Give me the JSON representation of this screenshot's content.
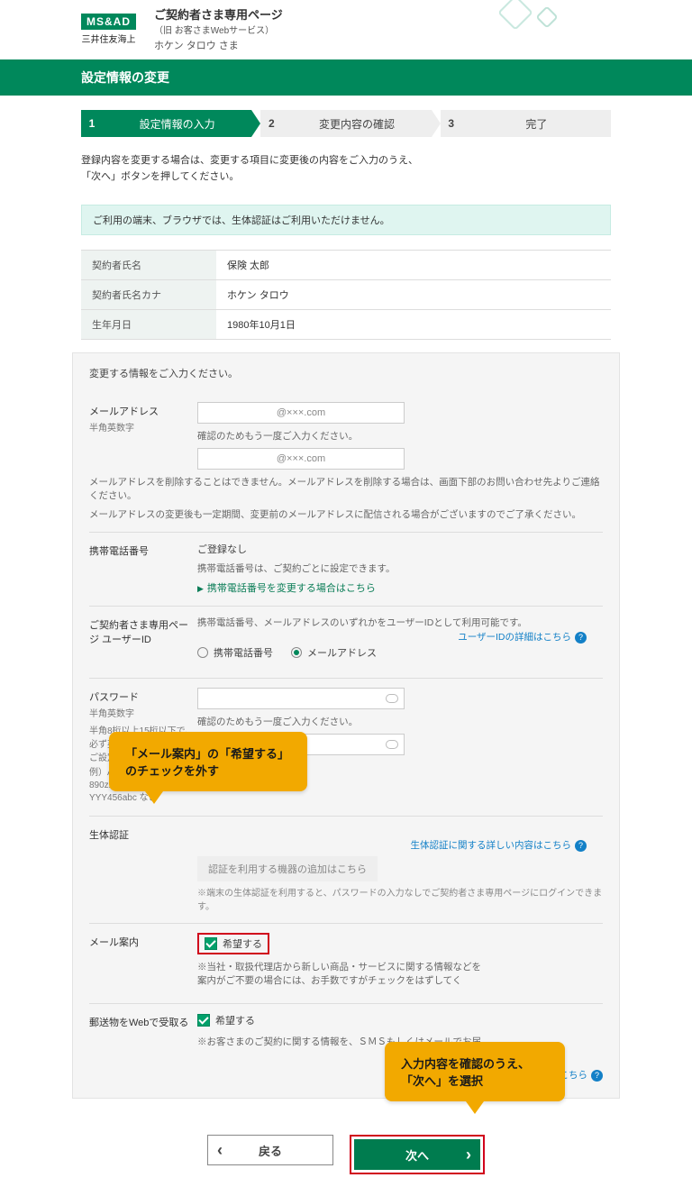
{
  "header": {
    "brand_logo": "MS&AD",
    "brand_sub": "三井住友海上",
    "page_owner_title": "ご契約者さま専用ページ",
    "page_owner_sub": "（旧 お客さまWebサービス）",
    "user_greeting": "ホケン タロウ さま"
  },
  "title": "設定情報の変更",
  "steps": [
    {
      "num": "1",
      "label": "設定情報の入力",
      "active": true
    },
    {
      "num": "2",
      "label": "変更内容の確認",
      "active": false
    },
    {
      "num": "3",
      "label": "完了",
      "active": false
    }
  ],
  "intro_line1": "登録内容を変更する場合は、変更する項目に変更後の内容をご入力のうえ、",
  "intro_line2": "「次へ」ボタンを押してください。",
  "notice": "ご利用の端末、ブラウザでは、生体認証はご利用いただけません。",
  "info": {
    "name_label": "契約者氏名",
    "name_value": "保険 太郎",
    "kana_label": "契約者氏名カナ",
    "kana_value": "ホケン タロウ",
    "dob_label": "生年月日",
    "dob_value": "1980年10月1日"
  },
  "panel_intro": "変更する情報をご入力ください。",
  "email": {
    "label": "メールアドレス",
    "sublabel": "半角英数字",
    "value": "@×××.com",
    "confirm_hint": "確認のためもう一度ご入力ください。",
    "confirm_value": "@×××.com",
    "delete_note": "メールアドレスを削除することはできません。メールアドレスを削除する場合は、画面下部のお問い合わせ先よりご連絡ください。",
    "retain_note": "メールアドレスの変更後も一定期間、変更前のメールアドレスに配信される場合がございますのでご了承ください。"
  },
  "mobile": {
    "label": "携帯電話番号",
    "none": "ご登録なし",
    "per_contract": "携帯電話番号は、ご契約ごとに設定できます。",
    "change_link": "携帯電話番号を変更する場合はこちら"
  },
  "userid": {
    "label": "ご契約者さま専用ページ ユーザーID",
    "desc": "携帯電話番号、メールアドレスのいずれかをユーザーIDとして利用可能です。",
    "opt_phone": "携帯電話番号",
    "opt_email": "メールアドレス",
    "detail_link": "ユーザーIDの詳細はこちら"
  },
  "password": {
    "label": "パスワード",
    "sublabel": "半角英数字",
    "rule": "半角8桁以上15桁以下で、必ず英字と数字を混ぜてご設定ください。",
    "confirm_hint": "確認のためもう一度ご入力ください。",
    "example_label": "例）Abc12345、890zXY1234、YYY456abc など"
  },
  "biometric": {
    "label": "生体認証",
    "add_device": "認証を利用する機器の追加はこちら",
    "note": "※端末の生体認証を利用すると、パスワードの入力なしでご契約者さま専用ページにログインできます。",
    "detail_link": "生体認証に関する詳しい内容はこちら"
  },
  "mail_guide": {
    "label": "メール案内",
    "want": "希望する",
    "note": "※当社・取扱代理店から新しい商品・サービスに関する情報などを\n案内がご不要の場合には、お手数ですがチェックをはずしてく"
  },
  "postal_web": {
    "label": "郵送物をWebで受取る",
    "want": "希望する",
    "note": "※お客さまのご契約に関する情報を、ＳＭＳもしくはメールでお届",
    "detail_link": "い内容はこちら"
  },
  "buttons": {
    "back": "戻る",
    "next": "次へ"
  },
  "callouts": {
    "c1_line1": "「メール案内」の「希望する」",
    "c1_line2": "のチェックを外す",
    "c2_line1": "入力内容を確認のうえ、",
    "c2_line2": "「次へ」を選択"
  }
}
